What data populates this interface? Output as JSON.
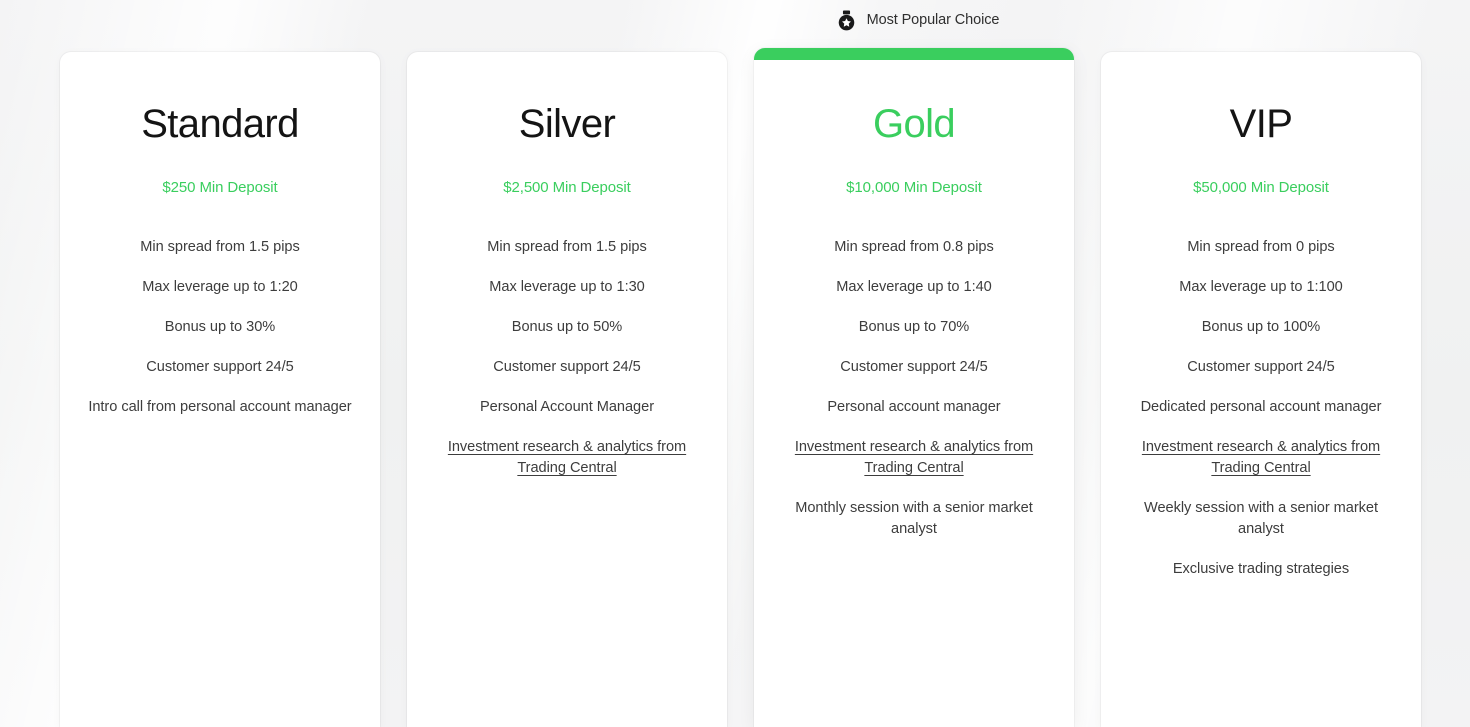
{
  "banner": {
    "icon": "medal-star-icon",
    "label": "Most Popular Choice"
  },
  "colors": {
    "accent_green": "#3ace5e",
    "title_dark": "#141414",
    "feature_text": "#3d3d3d",
    "page_background": "#f2f3f3",
    "card_background": "#ffffff"
  },
  "cards": [
    {
      "title": "Standard",
      "deposit": "$250 Min Deposit",
      "featured": false,
      "features": [
        {
          "text": "Min spread from 1.5 pips",
          "link": false
        },
        {
          "text": "Max leverage up to 1:20",
          "link": false
        },
        {
          "text": "Bonus up to 30%",
          "link": false
        },
        {
          "text": "Customer support 24/5",
          "link": false
        },
        {
          "text": "Intro call from personal account manager",
          "link": false
        }
      ]
    },
    {
      "title": "Silver",
      "deposit": "$2,500 Min Deposit",
      "featured": false,
      "features": [
        {
          "text": "Min spread from 1.5 pips",
          "link": false
        },
        {
          "text": "Max leverage up to 1:30",
          "link": false
        },
        {
          "text": "Bonus up to 50%",
          "link": false
        },
        {
          "text": "Customer support 24/5",
          "link": false
        },
        {
          "text": "Personal Account Manager",
          "link": false
        },
        {
          "text": "Investment research & analytics from Trading Central",
          "link": true
        }
      ]
    },
    {
      "title": "Gold",
      "deposit": "$10,000 Min Deposit",
      "featured": true,
      "features": [
        {
          "text": "Min spread from 0.8 pips",
          "link": false
        },
        {
          "text": "Max leverage up to 1:40",
          "link": false
        },
        {
          "text": "Bonus up to 70%",
          "link": false
        },
        {
          "text": "Customer support 24/5",
          "link": false
        },
        {
          "text": "Personal account manager",
          "link": false
        },
        {
          "text": "Investment research & analytics from Trading Central",
          "link": true
        },
        {
          "text": "Monthly session with a senior market analyst",
          "link": false
        }
      ]
    },
    {
      "title": "VIP",
      "deposit": "$50,000 Min Deposit",
      "featured": false,
      "features": [
        {
          "text": "Min spread from 0 pips",
          "link": false
        },
        {
          "text": "Max leverage up to 1:100",
          "link": false
        },
        {
          "text": "Bonus up to 100%",
          "link": false
        },
        {
          "text": "Customer support 24/5",
          "link": false
        },
        {
          "text": "Dedicated personal account manager",
          "link": false
        },
        {
          "text": "Investment research & analytics from Trading Central",
          "link": true
        },
        {
          "text": "Weekly session with a senior market analyst",
          "link": false
        },
        {
          "text": "Exclusive trading strategies",
          "link": false
        }
      ]
    }
  ]
}
